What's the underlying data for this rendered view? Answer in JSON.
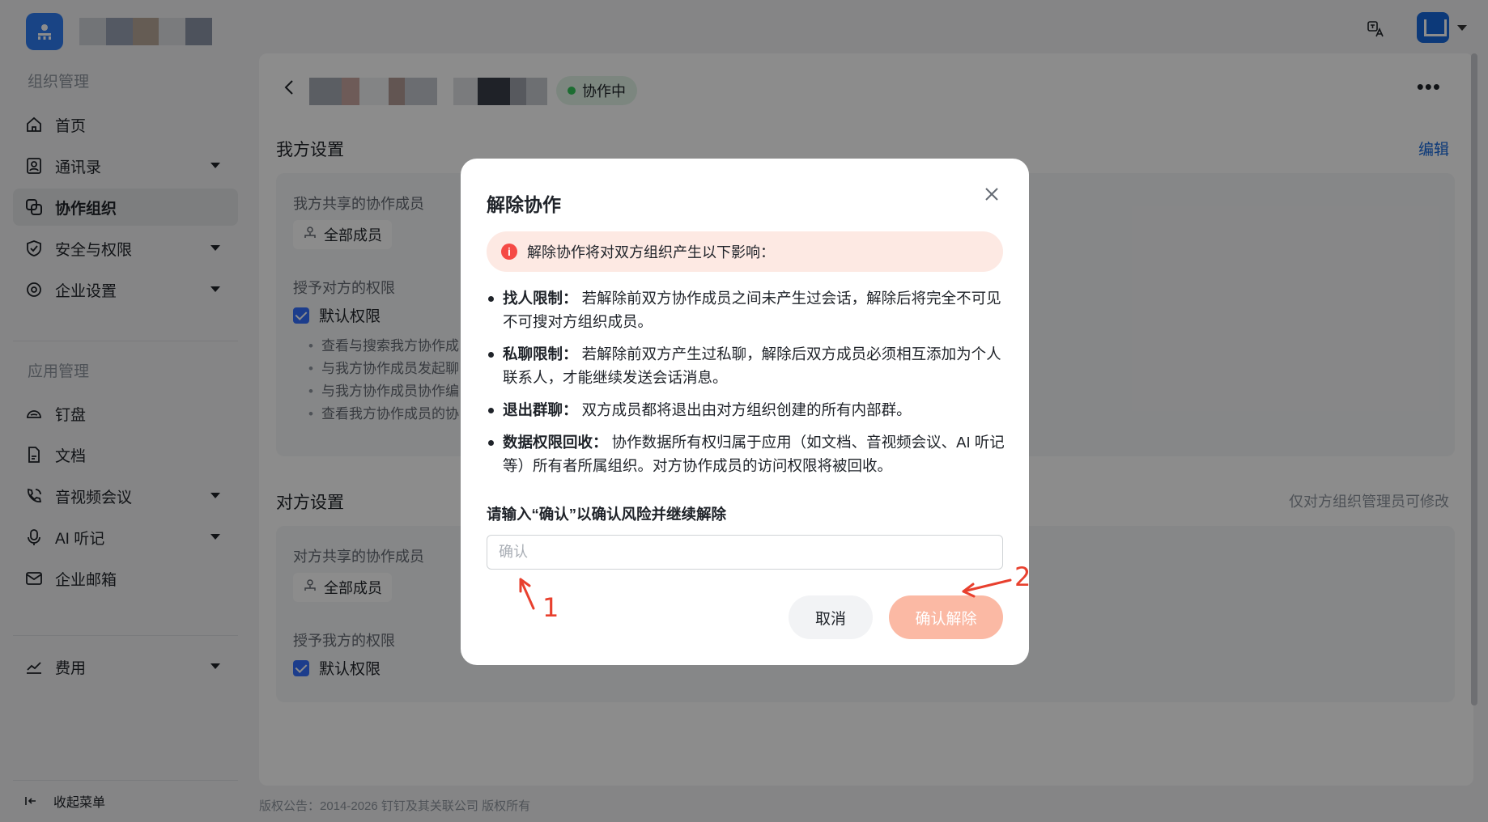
{
  "colors": {
    "primary": "#1668dc",
    "status_green": "#34c759",
    "danger": "#f54a45",
    "confirm_button": "#fbb9a4",
    "annotation": "#e8402e"
  },
  "sidebar": {
    "section_org": "组织管理",
    "section_app": "应用管理",
    "items": [
      {
        "label": "首页",
        "icon": "home-icon"
      },
      {
        "label": "通讯录",
        "icon": "contacts-icon"
      },
      {
        "label": "协作组织",
        "icon": "collab-icon"
      },
      {
        "label": "安全与权限",
        "icon": "shield-icon"
      },
      {
        "label": "企业设置",
        "icon": "settings-icon"
      },
      {
        "label": "钉盘",
        "icon": "cloud-icon"
      },
      {
        "label": "文档",
        "icon": "doc-icon"
      },
      {
        "label": "音视频会议",
        "icon": "phone-icon"
      },
      {
        "label": "AI 听记",
        "icon": "ai-icon"
      },
      {
        "label": "企业邮箱",
        "icon": "mail-icon"
      },
      {
        "label": "费用",
        "icon": "chart-icon"
      }
    ],
    "collapse_label": "收起菜单"
  },
  "header": {
    "status": "协作中"
  },
  "my_settings": {
    "title": "我方设置",
    "edit": "编辑",
    "shared_members_label": "我方共享的协作成员",
    "all_members": "全部成员",
    "grant_label": "授予对方的权限",
    "default_perm": "默认权限",
    "perm_items": [
      "查看与搜索我方协作成",
      "与我方协作成员发起聊",
      "与我方协作成员协作编",
      "查看我方协作成员的协"
    ]
  },
  "their_settings": {
    "title": "对方设置",
    "hint": "仅对方组织管理员可修改",
    "shared_members_label": "对方共享的协作成员",
    "all_members": "全部成员",
    "grant_label": "授予我方的权限",
    "default_perm": "默认权限"
  },
  "footer": "版权公告：2014-2026 钉钉及其关联公司 版权所有",
  "modal": {
    "title": "解除协作",
    "alert": "解除协作将对双方组织产生以下影响：",
    "bullets": [
      {
        "head": "找人限制：",
        "text": "若解除前双方协作成员之间未产生过会话，解除后将完全不可见不可搜对方组织成员。"
      },
      {
        "head": "私聊限制：",
        "text": "若解除前双方产生过私聊，解除后双方成员必须相互添加为个人联系人，才能继续发送会话消息。"
      },
      {
        "head": "退出群聊：",
        "text": "双方成员都将退出由对方组织创建的所有内部群。"
      },
      {
        "head": "数据权限回收：",
        "text": "协作数据所有权归属于应用（如文档、音视频会议、AI 听记等）所有者所属组织。对方协作成员的访问权限将被回收。"
      }
    ],
    "confirm_label": "请输入“确认”以确认风险并继续解除",
    "input_placeholder": "确认",
    "input_value": "",
    "cancel": "取消",
    "confirm": "确认解除"
  },
  "annotations": {
    "one": "1",
    "two": "2"
  }
}
